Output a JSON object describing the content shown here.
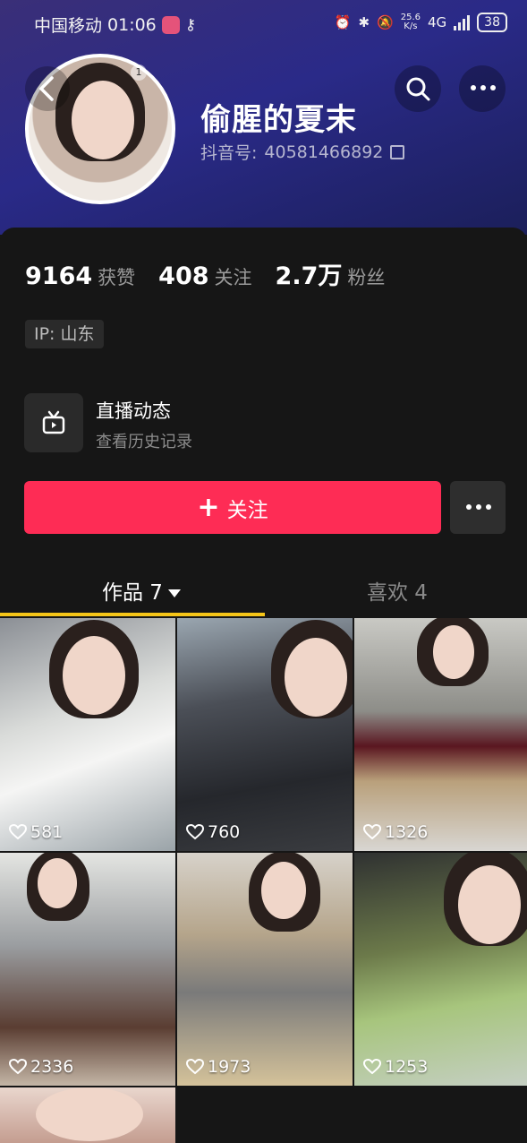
{
  "status_bar": {
    "carrier": "中国移动",
    "time": "01:06",
    "net_speed_value": "25.6",
    "net_speed_unit": "K/s",
    "network": "4G",
    "battery": "38"
  },
  "profile": {
    "nickname": "偷腥的夏末",
    "douyin_id_label": "抖音号:",
    "douyin_id": "40581466892",
    "avatar_badge": "1"
  },
  "stats": [
    {
      "value": "9164",
      "label": "获赞"
    },
    {
      "value": "408",
      "label": "关注"
    },
    {
      "value": "2.7万",
      "label": "粉丝"
    }
  ],
  "ip_tag": "IP:  山东",
  "live": {
    "title": "直播动态",
    "subtitle": "查看历史记录"
  },
  "follow_button": {
    "plus": "+",
    "label": "关注"
  },
  "tabs": [
    {
      "label": "作品 7"
    },
    {
      "label": "喜欢 4"
    }
  ],
  "grid_likes": [
    "581",
    "760",
    "1326",
    "2336",
    "1973",
    "1253"
  ],
  "colors": {
    "accent": "#fe2c55",
    "tab_underline": "#f5c518",
    "background": "#161616"
  }
}
